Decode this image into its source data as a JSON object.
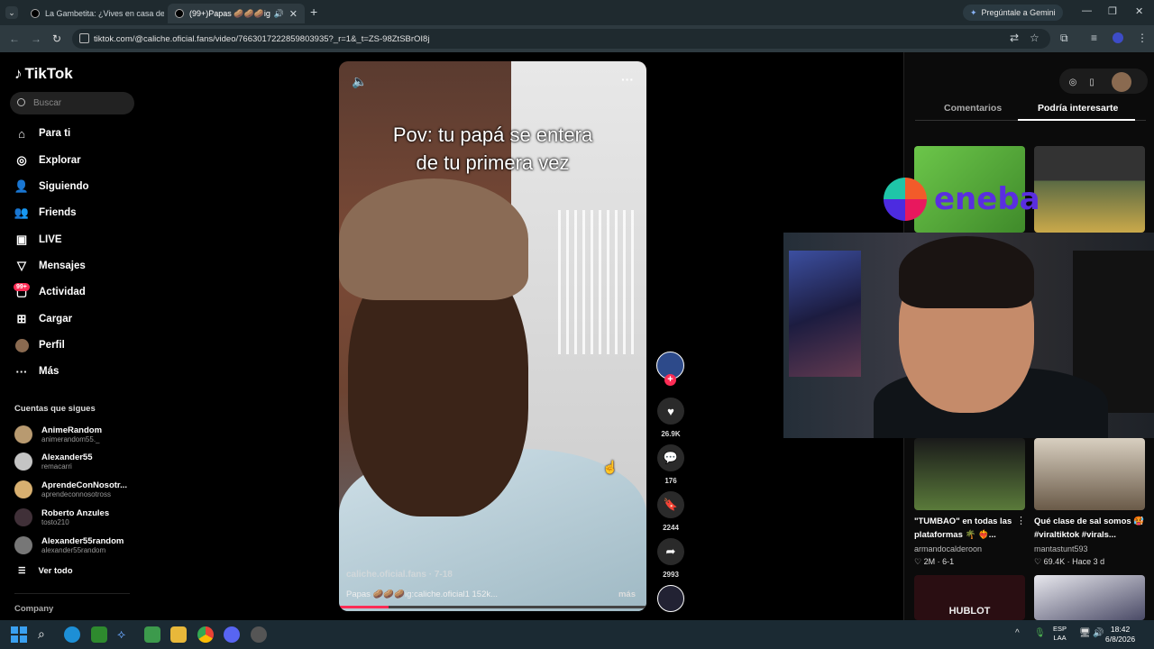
{
  "browser": {
    "tabs": [
      {
        "title": "La Gambetita: ¿Vives en casa de..."
      },
      {
        "title": "(99+)Papas 🥔🥔🥔ig:calic..."
      }
    ],
    "url": "tiktok.com/@caliche.oficial.fans/video/7663017222859803935?_r=1&_t=ZS-98ZtSBrOI8j",
    "gemini_label": "Pregúntale a Gemini"
  },
  "sidebar": {
    "logo": "TikTok",
    "search_placeholder": "Buscar",
    "nav": [
      {
        "label": "Para ti",
        "icon": "home-icon"
      },
      {
        "label": "Explorar",
        "icon": "compass-icon"
      },
      {
        "label": "Siguiendo",
        "icon": "following-icon"
      },
      {
        "label": "Friends",
        "icon": "friends-icon"
      },
      {
        "label": "LIVE",
        "icon": "live-icon"
      },
      {
        "label": "Mensajes",
        "icon": "messages-icon"
      },
      {
        "label": "Actividad",
        "icon": "activity-icon"
      },
      {
        "label": "Cargar",
        "icon": "upload-icon"
      },
      {
        "label": "Perfil",
        "icon": "profile-avatar"
      },
      {
        "label": "Más",
        "icon": "more-icon"
      }
    ],
    "activity_badge": "99+",
    "following_header": "Cuentas que sigues",
    "accounts": [
      {
        "name": "AnimeRandom",
        "handle": "animerandom55._"
      },
      {
        "name": "Alexander55",
        "handle": "remacarri"
      },
      {
        "name": "AprendeConNosotr...",
        "handle": "aprendeconnosotross"
      },
      {
        "name": "Roberto Anzules",
        "handle": "tosto210"
      },
      {
        "name": "Alexander55random",
        "handle": "alexander55random"
      }
    ],
    "see_all": "Ver todo",
    "company": "Company"
  },
  "video": {
    "caption_line1": "Pov: tu papá se entera",
    "caption_line2": "de tu primera vez",
    "author": "caliche.oficial.fans · 7-18",
    "description": "Papas 🥔🥔🥔ig:caliche.oficial1 152k...",
    "more": "más",
    "progress": 0.16
  },
  "actions": {
    "likes": "26.9K",
    "comments": "176",
    "saves": "2244",
    "shares": "2993"
  },
  "right_panel": {
    "tab_comments": "Comentarios",
    "tab_interest": "Podría interesarte",
    "cards": [
      {
        "title": "\"TUMBAO\" en todas las plataformas 🌴 ❤️‍🔥...",
        "author": "armandocalderoon",
        "likes": "2M",
        "date": "6-1"
      },
      {
        "title": "Qué clase de sal somos 🥵#viraltiktok #virals...",
        "author": "mantastunt593",
        "likes": "69.4K",
        "date": "Hace 3 d"
      }
    ],
    "hublot_text": "HUBLOT"
  },
  "overlay": {
    "brand": "eneba"
  },
  "taskbar": {
    "lang_line1": "ESP",
    "lang_line2": "LAA",
    "time": "18:42",
    "date": "6/8/2026"
  }
}
